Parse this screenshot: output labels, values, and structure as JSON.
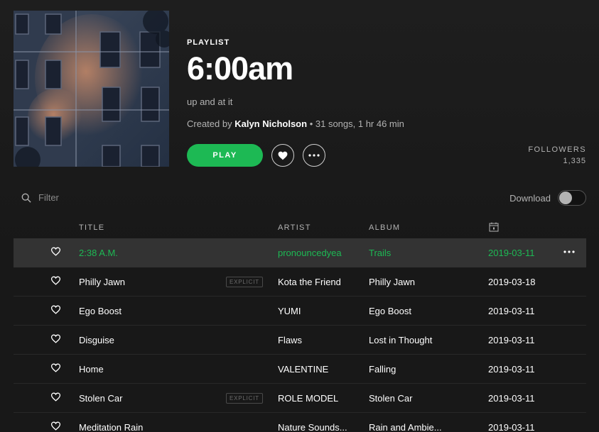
{
  "playlist": {
    "type_label": "PLAYLIST",
    "title": "6:00am",
    "description": "up and at it",
    "created_prefix": "Created by",
    "owner": "Kalyn Nicholson",
    "stats": "• 31 songs, 1 hr 46 min"
  },
  "actions": {
    "play_label": "PLAY",
    "like_icon": "heart-outline-icon",
    "more_icon": "ellipsis-icon"
  },
  "followers": {
    "label": "FOLLOWERS",
    "count": "1,335"
  },
  "filter": {
    "placeholder": "Filter"
  },
  "download": {
    "label": "Download",
    "enabled": false
  },
  "columns": {
    "title": "TITLE",
    "artist": "ARTIST",
    "album": "ALBUM",
    "date_icon": "calendar-icon"
  },
  "tracks": [
    {
      "title": "2:38 A.M.",
      "explicit": "",
      "artist": "pronouncedyea",
      "album": "Trails",
      "date": "2019-03-11",
      "active": true
    },
    {
      "title": "Philly Jawn",
      "explicit": "EXPLICIT",
      "artist": "Kota the Friend",
      "album": "Philly Jawn",
      "date": "2019-03-18"
    },
    {
      "title": "Ego Boost",
      "explicit": "",
      "artist": "YUMI",
      "album": "Ego Boost",
      "date": "2019-03-11"
    },
    {
      "title": "Disguise",
      "explicit": "",
      "artist": "Flaws",
      "album": "Lost in Thought",
      "date": "2019-03-11"
    },
    {
      "title": "Home",
      "explicit": "",
      "artist": "VALENTINE",
      "album": "Falling",
      "date": "2019-03-11"
    },
    {
      "title": "Stolen Car",
      "explicit": "EXPLICIT",
      "artist": "ROLE MODEL",
      "album": "Stolen Car",
      "date": "2019-03-11"
    },
    {
      "title": "Meditation Rain",
      "explicit": "",
      "artist": "Nature Sounds...",
      "album": "Rain and Ambie...",
      "date": "2019-03-11"
    }
  ],
  "colors": {
    "accent": "#1db954",
    "background": "#181818",
    "active_row": "#333333",
    "muted_text": "#b3b3b3"
  }
}
